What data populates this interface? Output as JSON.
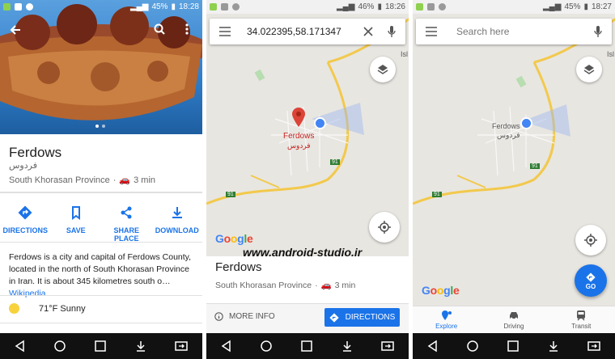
{
  "panel1": {
    "status": {
      "battery": "45%",
      "time": "18:28"
    },
    "place": {
      "name": "Ferdows",
      "local_name": "فردوس",
      "province": "South Khorasan Province",
      "drive_time": "3 min"
    },
    "actions": [
      {
        "label": "DIRECTIONS"
      },
      {
        "label": "SAVE"
      },
      {
        "label": "SHARE PLACE"
      },
      {
        "label": "DOWNLOAD"
      }
    ],
    "description": "Ferdows is a city and capital of Ferdows County, located in the north of South Khorasan Province in Iran. It is about 345 kilometres south o…",
    "wiki_link": "Wikipedia",
    "weather": "71°F Sunny"
  },
  "panel2": {
    "status": {
      "battery": "46%",
      "time": "18:26"
    },
    "search": {
      "query": "34.022395,58.171347"
    },
    "map": {
      "place_label": "Ferdows",
      "place_label_local": "فردوس",
      "road_label": "91",
      "road_label_2": "91",
      "corner_label": "Isl"
    },
    "google": "Google",
    "place": {
      "name": "Ferdows",
      "province": "South Khorasan Province",
      "drive_time": "3 min"
    },
    "more_info": "MORE INFO",
    "directions": "DIRECTIONS"
  },
  "panel3": {
    "status": {
      "battery": "45%",
      "time": "18:27"
    },
    "search": {
      "placeholder": "Search here"
    },
    "map": {
      "place_label": "Ferdows",
      "place_label_local": "فردوس",
      "road_label": "91",
      "road_label_2": "91",
      "corner_label": "Isl"
    },
    "google": "Google",
    "go": "GO",
    "tabs": [
      {
        "label": "Explore"
      },
      {
        "label": "Driving"
      },
      {
        "label": "Transit"
      }
    ]
  },
  "watermark": "www.android-studio.ir",
  "colors": {
    "accent": "#1a73e8",
    "map_bg": "#e8e6e1",
    "road": "#f2c94c"
  }
}
